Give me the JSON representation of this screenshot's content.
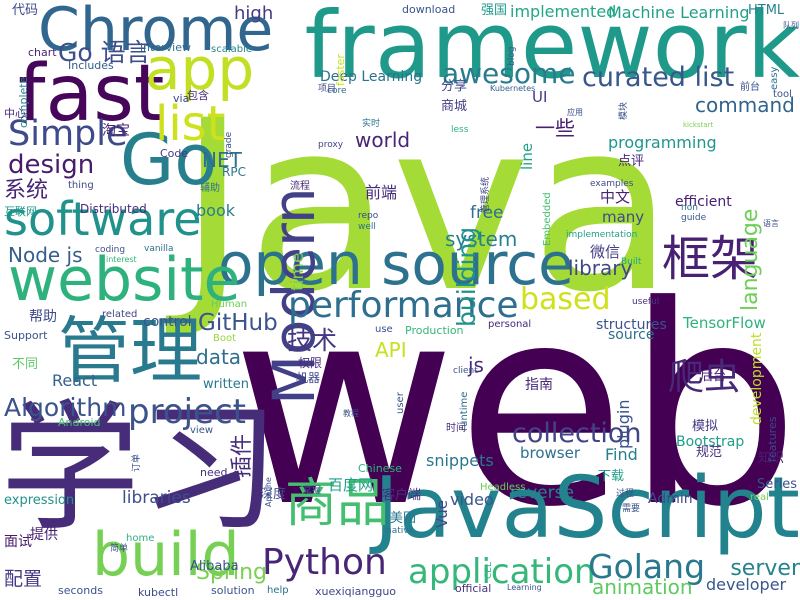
{
  "word_cloud": {
    "words": [
      {
        "text": "Java",
        "color": "#a5db36"
      },
      {
        "text": "web",
        "color": "#440154"
      },
      {
        "text": "学习",
        "color": "#472c7a"
      },
      {
        "text": "framework",
        "color": "#1f9a8a"
      },
      {
        "text": "JavaScript",
        "color": "#22828e"
      },
      {
        "text": "Chrome",
        "color": "#31668e"
      },
      {
        "text": "fast",
        "color": "#46075a"
      },
      {
        "text": "app",
        "color": "#c2df23"
      },
      {
        "text": "Go",
        "color": "#277f8e"
      },
      {
        "text": "open source",
        "color": "#2c718e"
      },
      {
        "text": "website",
        "color": "#2db27d"
      },
      {
        "text": "管理",
        "color": "#297a8e"
      },
      {
        "text": "software",
        "color": "#21918c"
      },
      {
        "text": "build",
        "color": "#75d054"
      },
      {
        "text": "商品",
        "color": "#44bf70"
      },
      {
        "text": "Modern",
        "color": "#424086"
      },
      {
        "text": "list",
        "color": "#cde11d"
      },
      {
        "text": "框架",
        "color": "#482173"
      },
      {
        "text": "project",
        "color": "#3b528b"
      },
      {
        "text": "Simple",
        "color": "#3e4a89"
      },
      {
        "text": "performance",
        "color": "#2e6e8e"
      },
      {
        "text": "application",
        "color": "#35b779"
      },
      {
        "text": "Golang",
        "color": "#2a788e"
      },
      {
        "text": "Python",
        "color": "#482576"
      },
      {
        "text": "awesome",
        "color": "#287c8e"
      },
      {
        "text": "curated list",
        "color": "#38588c"
      },
      {
        "text": "collection",
        "color": "#414487"
      },
      {
        "text": "based",
        "color": "#d0e11c"
      },
      {
        "text": "Algorithm",
        "color": "#3b528b"
      },
      {
        "text": "爬虫",
        "color": "#482878"
      },
      {
        "text": "Go 语言",
        "color": "#3d4e8a"
      },
      {
        "text": "design",
        "color": "#481b6d"
      },
      {
        "text": "system",
        "color": "#26818e"
      },
      {
        "text": "library",
        "color": "#3f4788"
      },
      {
        "text": "language",
        "color": "#6ece58"
      },
      {
        "text": "command",
        "color": "#33638d"
      },
      {
        "text": "Spring",
        "color": "#7ad151"
      },
      {
        "text": "server",
        "color": "#25838e"
      },
      {
        "text": "animation",
        "color": "#5ec962"
      },
      {
        "text": "GitHub",
        "color": "#3a548c"
      },
      {
        "text": "world",
        "color": "#482475"
      },
      {
        "text": "Node js",
        "color": "#355e8d"
      },
      {
        "text": "技术",
        "color": "#453882"
      },
      {
        "text": "building",
        "color": "#21918c"
      },
      {
        "text": "Machine Learning",
        "color": "#1fa187"
      },
      {
        "text": "implemented",
        "color": "#22a785"
      },
      {
        "text": "high",
        "color": "#443a83"
      },
      {
        "text": "data",
        "color": "#2e6f8e"
      },
      {
        "text": "programming",
        "color": "#1f968b"
      },
      {
        "text": "API",
        "color": "#c8e020"
      },
      {
        "text": "js",
        "color": "#472f7d"
      },
      {
        "text": "系统",
        "color": "#482677"
      },
      {
        "text": "NET",
        "color": "#2d708e"
      },
      {
        "text": "free",
        "color": "#2e6e8e"
      },
      {
        "text": "time",
        "color": "#7fd34e"
      },
      {
        "text": "React",
        "color": "#34618d"
      },
      {
        "text": "snippets",
        "color": "#2a768e"
      },
      {
        "text": "reverse",
        "color": "#26828e"
      },
      {
        "text": "video",
        "color": "#39558c"
      },
      {
        "text": "libraries",
        "color": "#3d4e8a"
      },
      {
        "text": "developer",
        "color": "#39568c"
      },
      {
        "text": "book",
        "color": "#287c8e"
      },
      {
        "text": "Vue",
        "color": "#3f4788"
      },
      {
        "text": "plugin",
        "color": "#3b528b"
      },
      {
        "text": "插件",
        "color": "#472d7b"
      },
      {
        "text": "Find",
        "color": "#277f8e"
      },
      {
        "text": "browser",
        "color": "#2d708e"
      },
      {
        "text": "中文",
        "color": "#482475"
      },
      {
        "text": "many",
        "color": "#3e4989"
      },
      {
        "text": "TensorFlow",
        "color": "#2db27d"
      },
      {
        "text": "development",
        "color": "#bddf26"
      },
      {
        "text": "structures",
        "color": "#3b528b"
      },
      {
        "text": "source",
        "color": "#2d708e"
      },
      {
        "text": "Deep Learning",
        "color": "#2c718e"
      },
      {
        "text": "一些",
        "color": "#482071"
      },
      {
        "text": "前端",
        "color": "#472a7a"
      },
      {
        "text": "微信",
        "color": "#433e85"
      },
      {
        "text": "line",
        "color": "#20a386"
      },
      {
        "text": "UI",
        "color": "#443983"
      },
      {
        "text": "efficient",
        "color": "#482173"
      },
      {
        "text": "Admin",
        "color": "#3e4a89"
      },
      {
        "text": "Series",
        "color": "#3b528b"
      },
      {
        "text": "指南",
        "color": "#482979"
      },
      {
        "text": "百度网",
        "color": "#1fa088"
      },
      {
        "text": "客户端",
        "color": "#472f7d"
      },
      {
        "text": "control",
        "color": "#3b528b"
      },
      {
        "text": "Bootstrap",
        "color": "#1f9e89"
      },
      {
        "text": "written",
        "color": "#29798e"
      },
      {
        "text": "Distributed",
        "color": "#472d7b"
      },
      {
        "text": "帮助",
        "color": "#3e4989"
      },
      {
        "text": "权限",
        "color": "#472d7b"
      },
      {
        "text": "机器",
        "color": "#3f4889"
      },
      {
        "text": "配置",
        "color": "#443a83"
      },
      {
        "text": "面试",
        "color": "#481a6c"
      },
      {
        "text": "提供",
        "color": "#482071"
      },
      {
        "text": "深度",
        "color": "#3e4c8a"
      },
      {
        "text": "规范",
        "color": "#46337f"
      },
      {
        "text": "模拟",
        "color": "#453882"
      },
      {
        "text": "后台",
        "color": "#482071"
      },
      {
        "text": "知识",
        "color": "#481d6f"
      },
      {
        "text": "下载",
        "color": "#1fa088"
      },
      {
        "text": "美团",
        "color": "#2a788e"
      },
      {
        "text": "淘宝",
        "color": "#482677"
      },
      {
        "text": "分享",
        "color": "#3f4889"
      },
      {
        "text": "商城",
        "color": "#433e85"
      },
      {
        "text": "点评",
        "color": "#482878"
      },
      {
        "text": "代码",
        "color": "#3e4a89"
      },
      {
        "text": "强国",
        "color": "#1f988b"
      },
      {
        "text": "HTML",
        "color": "#25848e"
      },
      {
        "text": "Alibaba",
        "color": "#3b528b"
      },
      {
        "text": "expression",
        "color": "#21918c"
      },
      {
        "text": "Code",
        "color": "#443b84"
      },
      {
        "text": "RPC",
        "color": "#2b758e"
      },
      {
        "text": "interview",
        "color": "#2e6d8e"
      },
      {
        "text": "Includes",
        "color": "#365c8d"
      },
      {
        "text": "chart",
        "color": "#482475"
      },
      {
        "text": "via",
        "color": "#3f4788"
      },
      {
        "text": "包含",
        "color": "#472f7d"
      },
      {
        "text": "download",
        "color": "#39558c"
      },
      {
        "text": "faster",
        "color": "#cae11f"
      },
      {
        "text": "scalable",
        "color": "#24878e"
      },
      {
        "text": "easy",
        "color": "#2d708e"
      },
      {
        "text": "complete",
        "color": "#25848e"
      },
      {
        "text": "thing",
        "color": "#3e4989"
      },
      {
        "text": "need",
        "color": "#472f7d"
      },
      {
        "text": "real",
        "color": "#75d054"
      },
      {
        "text": "features",
        "color": "#3f4788"
      },
      {
        "text": "Production",
        "color": "#35b779"
      },
      {
        "text": "Human",
        "color": "#6ccd5a"
      },
      {
        "text": "Boot",
        "color": "#95d840"
      },
      {
        "text": "related",
        "color": "#414487"
      },
      {
        "text": "Support",
        "color": "#3b528b"
      },
      {
        "text": "personal",
        "color": "#482878"
      },
      {
        "text": "use",
        "color": "#3d4d8a"
      },
      {
        "text": "solution",
        "color": "#39568c"
      },
      {
        "text": "official",
        "color": "#46337f"
      },
      {
        "text": "seconds",
        "color": "#3b528b"
      },
      {
        "text": "kubectl",
        "color": "#3e4a89"
      },
      {
        "text": "help",
        "color": "#2d708e"
      },
      {
        "text": "xuexiqiangguo",
        "color": "#3f4788"
      },
      {
        "text": "Chinese",
        "color": "#2fb47c"
      },
      {
        "text": "Android",
        "color": "#44bf70"
      },
      {
        "text": "view",
        "color": "#39568c"
      },
      {
        "text": "home",
        "color": "#2db27d"
      },
      {
        "text": "Headless",
        "color": "#6ccd5a"
      },
      {
        "text": "implementation",
        "color": "#1fa088"
      },
      {
        "text": "examples",
        "color": "#3e4c8a"
      },
      {
        "text": "guide",
        "color": "#3a548c"
      },
      {
        "text": "non",
        "color": "#2a768e"
      },
      {
        "text": "grade",
        "color": "#3b528b"
      },
      {
        "text": "proxy",
        "color": "#3f4788"
      },
      {
        "text": "less",
        "color": "#2db27d"
      },
      {
        "text": "core",
        "color": "#2d708e"
      },
      {
        "text": "blog",
        "color": "#38598c"
      },
      {
        "text": "tool",
        "color": "#3b528b"
      },
      {
        "text": "coding",
        "color": "#3b528b"
      },
      {
        "text": "vanilla",
        "color": "#2d708e"
      },
      {
        "text": "interest",
        "color": "#2fb47c"
      },
      {
        "text": "repo",
        "color": "#3f4788"
      },
      {
        "text": "well",
        "color": "#2d708e"
      },
      {
        "text": "Built",
        "color": "#20a486"
      },
      {
        "text": "useful",
        "color": "#46337f"
      },
      {
        "text": "Embedded",
        "color": "#44bf70"
      },
      {
        "text": "runtime",
        "color": "#2d708e"
      },
      {
        "text": "user",
        "color": "#3b528b"
      },
      {
        "text": "client",
        "color": "#3b528b"
      },
      {
        "text": "native",
        "color": "#2d708e"
      },
      {
        "text": "Learning",
        "color": "#3b528b"
      },
      {
        "text": "CEL",
        "color": "#2db27d"
      },
      {
        "text": "Kubernetes",
        "color": "#355e8d"
      },
      {
        "text": "Apache",
        "color": "#3b528b"
      },
      {
        "text": "互联网",
        "color": "#1f968b"
      },
      {
        "text": "中心",
        "color": "#482878"
      },
      {
        "text": "项目",
        "color": "#3f4788"
      },
      {
        "text": "实时",
        "color": "#2d708e"
      },
      {
        "text": "管理系统",
        "color": "#3f4788"
      },
      {
        "text": "流程",
        "color": "#472d7b"
      },
      {
        "text": "辅助",
        "color": "#2d708e"
      },
      {
        "text": "时间",
        "color": "#472d7b"
      },
      {
        "text": "订单",
        "color": "#3b528b"
      },
      {
        "text": "教程",
        "color": "#3b528b"
      },
      {
        "text": "需要",
        "color": "#3b528b"
      },
      {
        "text": "过程",
        "color": "#3b528b"
      },
      {
        "text": "简单",
        "color": "#3b528b"
      },
      {
        "text": "语言",
        "color": "#3b528b"
      },
      {
        "text": "应用",
        "color": "#3b528b"
      },
      {
        "text": "前台",
        "color": "#3b528b"
      },
      {
        "text": "模块",
        "color": "#3b528b"
      },
      {
        "text": "队列",
        "color": "#3b528b"
      },
      {
        "text": "掌握",
        "color": "#3b528b"
      },
      {
        "text": "不同",
        "color": "#5ec962"
      },
      {
        "text": "kickstart",
        "color": "#7ad151"
      }
    ]
  }
}
